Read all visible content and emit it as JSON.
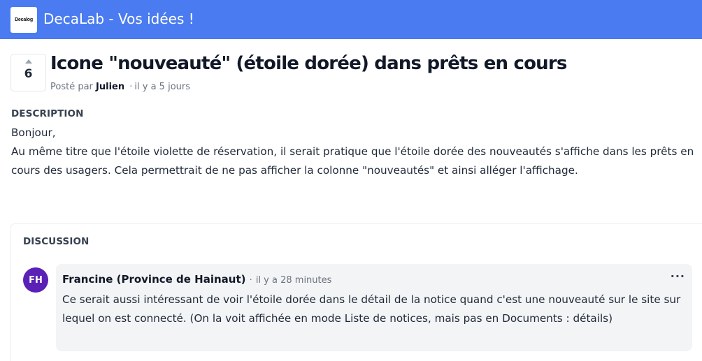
{
  "header": {
    "logo_text": "Decalog",
    "app_title": "DecaLab - Vos idées !",
    "bg_color": "#4a7bf0"
  },
  "post": {
    "vote_count": "6",
    "title": "Icone \"nouveauté\" (étoile dorée) dans prêts en cours",
    "posted_by_prefix": "Posté par",
    "author": "Julien",
    "separator": "·",
    "time": "il y a 5 jours"
  },
  "description": {
    "label": "DESCRIPTION",
    "lines": [
      "Bonjour,",
      "Au même titre que l'étoile violette de réservation, il serait pratique que l'étoile dorée des nouveautés s'affiche dans les prêts en cours des usagers. Cela permettrait de ne pas afficher la colonne \"nouveautés\" et ainsi alléger l'affichage."
    ]
  },
  "discussion": {
    "label": "DISCUSSION",
    "comments": [
      {
        "avatar_initials": "FH",
        "avatar_color": "#5b21b6",
        "author": "Francine (Province de Hainaut)",
        "separator": "·",
        "time": "il y a 28 minutes",
        "more_icon": "···",
        "body": "Ce serait aussi intéressant de voir l'étoile dorée dans le détail de la notice quand c'est une nouveauté sur le site sur lequel on est connecté. (On la voit affichée en mode Liste de notices, mais pas en Documents : détails)"
      }
    ]
  }
}
